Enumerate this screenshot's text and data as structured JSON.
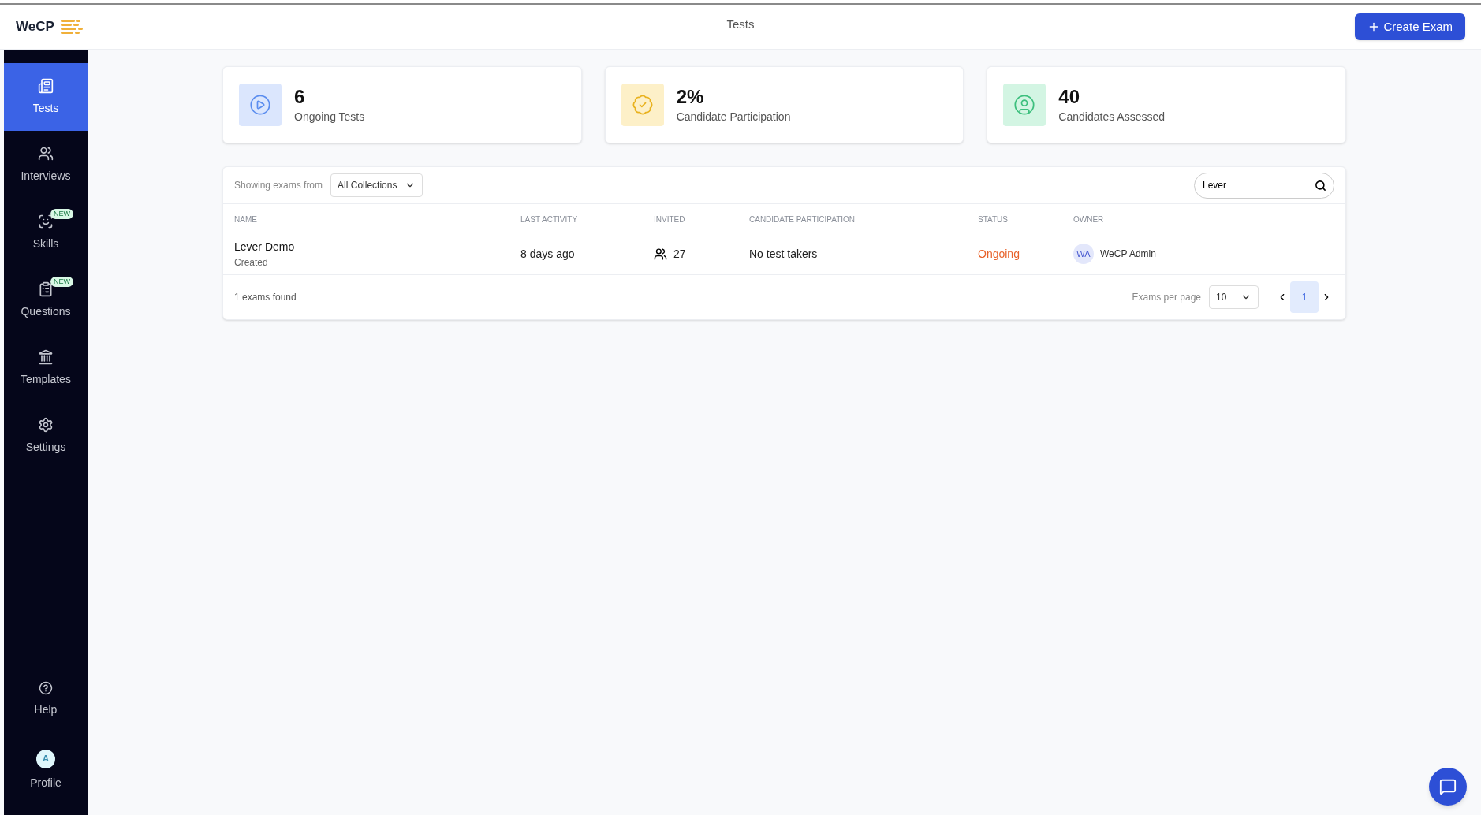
{
  "header": {
    "logo": "WeCP",
    "title": "Tests",
    "create_button": "Create Exam"
  },
  "sidebar": {
    "items": [
      {
        "label": "Tests",
        "kind": "tests",
        "selected": true
      },
      {
        "label": "Interviews",
        "kind": "interviews",
        "selected": false
      },
      {
        "label": "Skills",
        "kind": "skills",
        "selected": false,
        "badge": "NEW"
      },
      {
        "label": "Questions",
        "kind": "questions",
        "selected": false,
        "badge": "NEW"
      },
      {
        "label": "Templates",
        "kind": "templates",
        "selected": false
      },
      {
        "label": "Settings",
        "kind": "settings",
        "selected": false
      }
    ],
    "bottom_items": [
      {
        "label": "Help",
        "kind": "help"
      },
      {
        "label": "Profile",
        "kind": "profile",
        "avatar": "A"
      }
    ]
  },
  "stats": [
    {
      "value": "6",
      "label": "Ongoing Tests",
      "kind": "play"
    },
    {
      "value": "2%",
      "label": "Candidate Participation",
      "kind": "badge"
    },
    {
      "value": "40",
      "label": "Candidates Assessed",
      "kind": "user"
    }
  ],
  "table": {
    "filter_label": "Showing exams from",
    "filter_value": "All Collections",
    "search_value": "Lever",
    "columns": [
      "NAME",
      "LAST ACTIVITY",
      "INVITED",
      "CANDIDATE PARTICIPATION",
      "STATUS",
      "OWNER"
    ],
    "rows": [
      {
        "name": "Lever Demo",
        "sub": "Created",
        "last_activity": "8 days ago",
        "invited": "27",
        "participation": "No test takers",
        "status": "Ongoing",
        "owner_initials": "WA",
        "owner": "WeCP Admin"
      }
    ],
    "found": "1 exams found",
    "per_page_label": "Exams per page",
    "per_page": "10",
    "pages": [
      {
        "label": "1",
        "selected": true
      }
    ]
  }
}
